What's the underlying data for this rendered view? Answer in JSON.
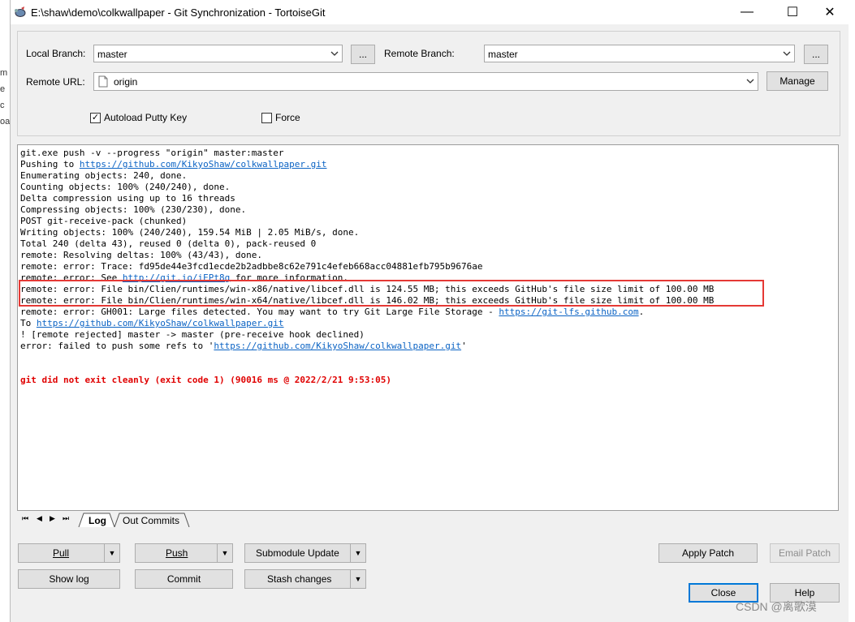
{
  "window": {
    "title": "E:\\shaw\\demo\\colkwallpaper - Git Synchronization - TortoiseGit",
    "minimize": "—",
    "maximize": "☐",
    "close": "✕"
  },
  "background_fragments": [
    "m",
    "e",
    "c",
    "oa"
  ],
  "branch": {
    "local_label": "Local Branch:",
    "local_value": "master",
    "local_browse": "...",
    "remote_label": "Remote Branch:",
    "remote_value": "master",
    "remote_browse": "...",
    "url_label": "Remote URL:",
    "url_value": "origin",
    "manage": "Manage"
  },
  "options": {
    "autoload": {
      "label": "Autoload Putty Key",
      "checked": true,
      "mark": "✓"
    },
    "force": {
      "label": "Force",
      "checked": false
    }
  },
  "log": {
    "lines": [
      {
        "text": "git.exe push -v --progress \"origin\" master:master"
      },
      {
        "text": "Pushing to ",
        "link": "https://github.com/KikyoShaw/colkwallpaper.git"
      },
      {
        "text": "Enumerating objects: 240, done."
      },
      {
        "text": "Counting objects: 100% (240/240), done."
      },
      {
        "text": "Delta compression using up to 16 threads"
      },
      {
        "text": "Compressing objects: 100% (230/230), done."
      },
      {
        "text": "POST git-receive-pack (chunked)"
      },
      {
        "text": "Writing objects: 100% (240/240), 159.54 MiB | 2.05 MiB/s, done."
      },
      {
        "text": "Total 240 (delta 43), reused 0 (delta 0), pack-reused 0"
      },
      {
        "text": "remote: Resolving deltas: 100% (43/43), done."
      },
      {
        "text": "remote: error: Trace: fd95de44e3fcd1ecde2b2adbbe8c62e791c4efeb668acc04881efb795b9676ae"
      },
      {
        "text": "remote: error: See ",
        "link": "http://git.io/iEPt8g",
        "after": " for more information."
      },
      {
        "text": "remote: error: File bin/Clien/runtimes/win-x86/native/libcef.dll is 124.55 MB; this exceeds GitHub's file size limit of 100.00 MB"
      },
      {
        "text": "remote: error: File bin/Clien/runtimes/win-x64/native/libcef.dll is 146.02 MB; this exceeds GitHub's file size limit of 100.00 MB"
      },
      {
        "text": "remote: error: GH001: Large files detected. You may want to try Git Large File Storage - ",
        "link": "https://git-lfs.github.com",
        "after": "."
      },
      {
        "text": "To ",
        "link": "https://github.com/KikyoShaw/colkwallpaper.git"
      },
      {
        "text": "! [remote rejected] master -> master (pre-receive hook declined)"
      },
      {
        "text": "error: failed to push some refs to '",
        "link": "https://github.com/KikyoShaw/colkwallpaper.git",
        "after": "'"
      },
      {
        "text": ""
      },
      {
        "text": ""
      },
      {
        "text": "git did not exit cleanly (exit code 1) (90016 ms @ 2022/2/21 9:53:05)",
        "error": true
      }
    ]
  },
  "tabs": {
    "nav": [
      "⏮",
      "◀",
      "▶",
      "⏭"
    ],
    "log": "Log",
    "out_commits": "Out Commits"
  },
  "buttons": {
    "pull": "Pull",
    "push": "Push",
    "submodule_update": "Submodule Update",
    "show_log": "Show log",
    "commit": "Commit",
    "stash_changes": "Stash changes",
    "apply_patch": "Apply Patch",
    "email_patch": "Email Patch",
    "close": "Close",
    "help": "Help",
    "dropdown_arrow": "▼"
  },
  "watermark": "CSDN @离歌漠"
}
